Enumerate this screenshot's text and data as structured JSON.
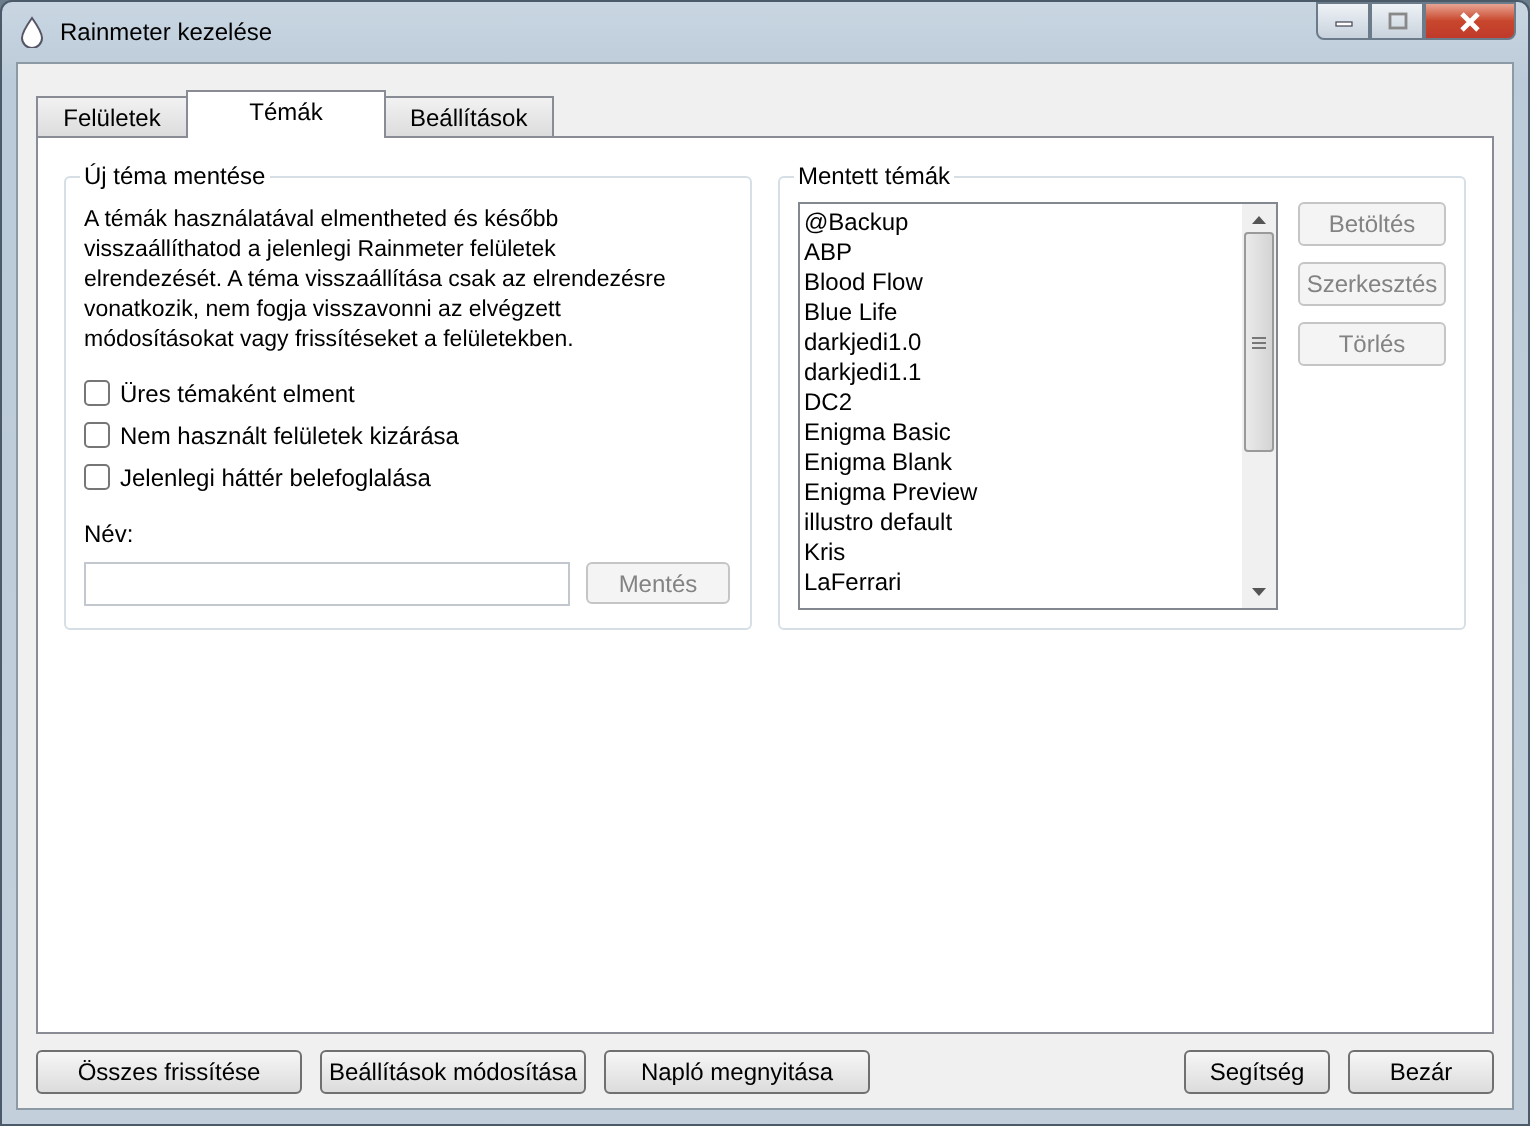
{
  "window": {
    "title": "Rainmeter kezelése"
  },
  "tabs": [
    {
      "label": "Felületek",
      "selected": false
    },
    {
      "label": "Témák",
      "selected": true
    },
    {
      "label": "Beállítások",
      "selected": false
    }
  ],
  "new_theme": {
    "title": "Új téma mentése",
    "description": "A témák használatával elmentheted és később visszaállíthatod a jelenlegi Rainmeter felületek elrendezését. A téma visszaállítása csak az elrendezésre vonatkozik, nem fogja visszavonni az elvégzett módosításokat vagy frissítéseket a felületekben.",
    "options": [
      {
        "label": "Üres témaként elment",
        "checked": false
      },
      {
        "label": "Nem használt felületek kizárása",
        "checked": false
      },
      {
        "label": "Jelenlegi háttér belefoglalása",
        "checked": false
      }
    ],
    "name_label": "Név:",
    "save_button": {
      "label": "Mentés",
      "disabled": true
    }
  },
  "saved_themes": {
    "title": "Mentett témák",
    "items": [
      "@Backup",
      "ABP",
      "Blood Flow",
      "Blue Life",
      "darkjedi1.0",
      "darkjedi1.1",
      "DC2",
      "Enigma Basic",
      "Enigma Blank",
      "Enigma Preview",
      "illustro default",
      "Kris",
      "LaFerrari"
    ],
    "buttons": [
      {
        "label": "Betöltés",
        "disabled": true
      },
      {
        "label": "Szerkesztés",
        "disabled": true
      },
      {
        "label": "Törlés",
        "disabled": true
      }
    ]
  },
  "footer": {
    "left_buttons": [
      "Összes frissítése",
      "Beállítások módosítása",
      "Napló megnyitása"
    ],
    "right_buttons": [
      "Segítség",
      "Bezár"
    ]
  }
}
